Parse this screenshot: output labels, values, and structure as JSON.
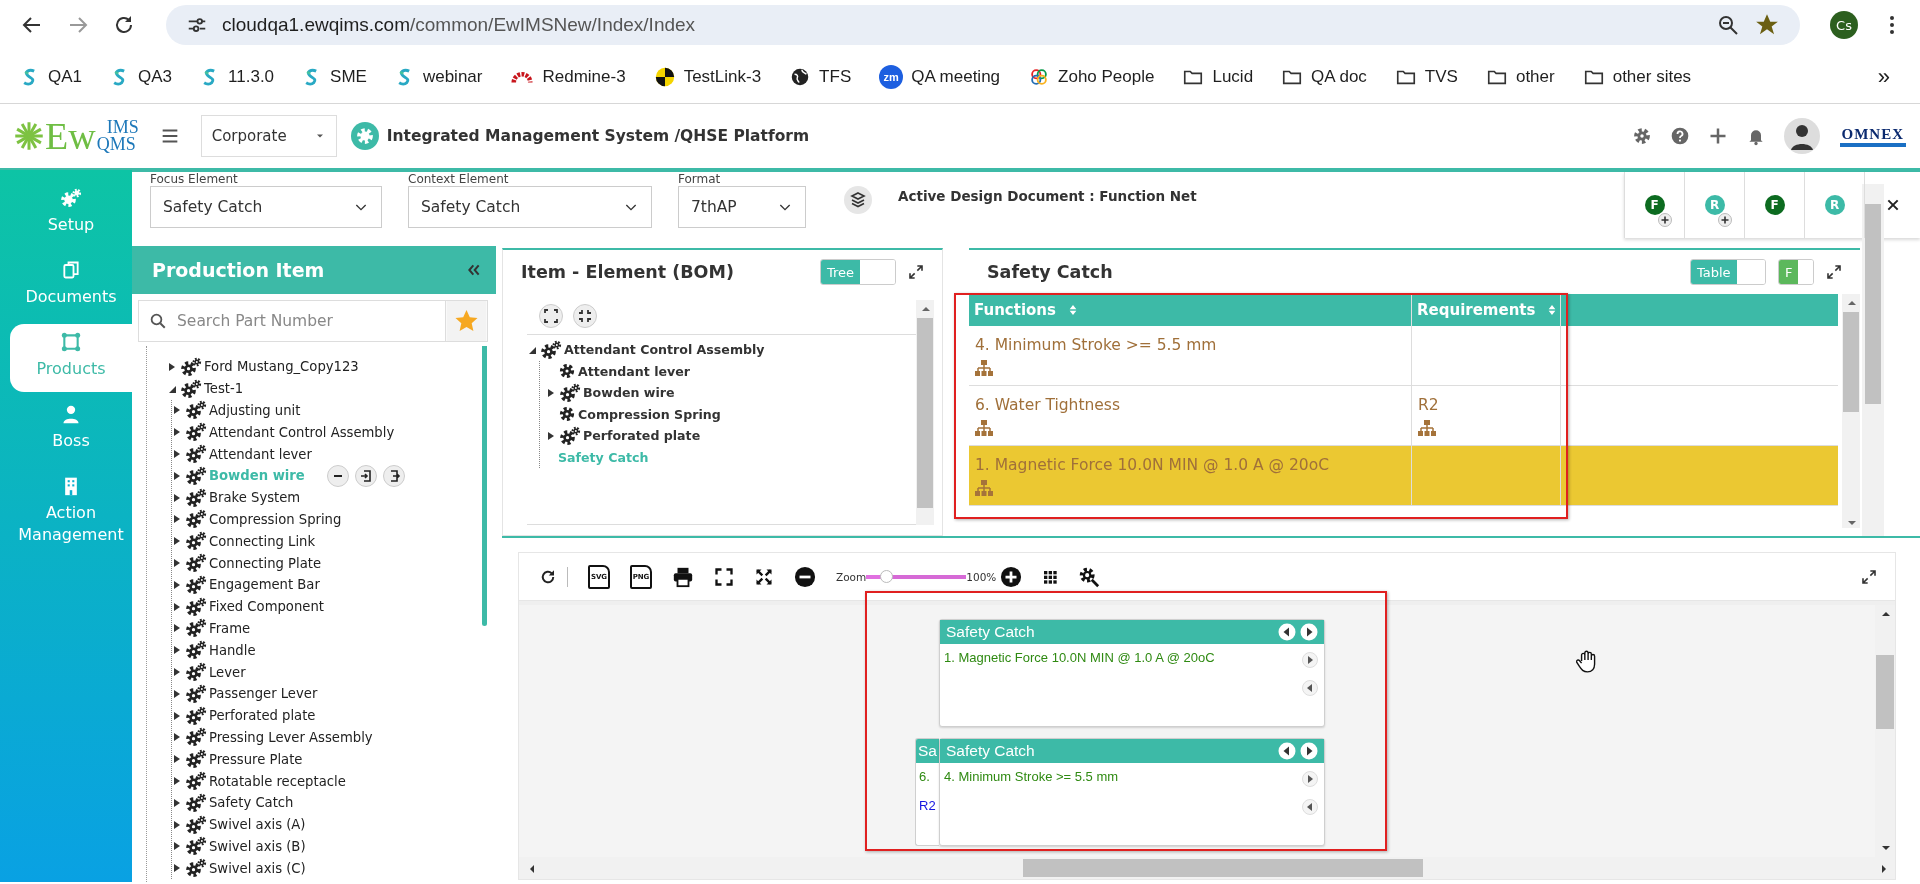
{
  "browser": {
    "url_host": "cloudqa1.ewqims.com",
    "url_path": "/common/EwIMSNew/Index/Index",
    "profile": "Cs"
  },
  "bookmarks": [
    {
      "label": "QA1",
      "kind": "ew"
    },
    {
      "label": "QA3",
      "kind": "ew"
    },
    {
      "label": "11.3.0",
      "kind": "ew"
    },
    {
      "label": "SME",
      "kind": "ew"
    },
    {
      "label": "webinar",
      "kind": "ew"
    },
    {
      "label": "Redmine-3",
      "kind": "redmine"
    },
    {
      "label": "TestLink-3",
      "kind": "testlink"
    },
    {
      "label": "TFS",
      "kind": "globe"
    },
    {
      "label": "QA meeting",
      "kind": "zm",
      "badge": "zm"
    },
    {
      "label": "Zoho People",
      "kind": "zoho"
    },
    {
      "label": "Lucid",
      "kind": "folder"
    },
    {
      "label": "QA doc",
      "kind": "folder"
    },
    {
      "label": "TVS",
      "kind": "folder"
    },
    {
      "label": "other",
      "kind": "folder"
    },
    {
      "label": "other sites",
      "kind": "folder"
    }
  ],
  "bookmarks_more": "»",
  "app": {
    "logo": {
      "main": "Ew",
      "top": "IMS",
      "bottom": "QMS"
    },
    "site": "Corporate",
    "title": "Integrated Management System /QHSE Platform",
    "brand": "OMNEX"
  },
  "nav": [
    {
      "label": "Setup",
      "kind": "gears",
      "selected": false
    },
    {
      "label": "Documents",
      "kind": "documents",
      "selected": false
    },
    {
      "label": "Products",
      "kind": "products",
      "selected": true
    },
    {
      "label": "Boss",
      "kind": "boss",
      "selected": false
    },
    {
      "label": "Action Management",
      "kind": "building",
      "selected": false
    }
  ],
  "filters": [
    {
      "label": "Focus Element",
      "value": "Safety Catch"
    },
    {
      "label": "Context Element",
      "value": "Safety Catch"
    },
    {
      "label": "Format",
      "value": "7thAP"
    }
  ],
  "active_document": "Active Design Document : Function Net",
  "view_buttons": [
    {
      "letter": "F",
      "kind": "function",
      "add": true
    },
    {
      "letter": "R",
      "kind": "requirement",
      "add": true
    },
    {
      "letter": "F",
      "kind": "function",
      "add": false
    },
    {
      "letter": "R",
      "kind": "requirement",
      "add": false
    }
  ],
  "production": {
    "title": "Production Item",
    "search_placeholder": "Search Part Number",
    "tree": [
      {
        "label": "Ford Mustang_Copy123",
        "expanded": false,
        "selected": false
      },
      {
        "label": "Test-1",
        "expanded": true,
        "selected": false,
        "children": [
          {
            "label": "Adjusting unit",
            "expanded": false,
            "selected": false
          },
          {
            "label": "Attendant Control Assembly",
            "expanded": false,
            "selected": false
          },
          {
            "label": "Attendant lever",
            "expanded": false,
            "selected": false
          },
          {
            "label": "Bowden wire",
            "expanded": false,
            "selected": true
          },
          {
            "label": "Brake System",
            "expanded": false,
            "selected": false
          },
          {
            "label": "Compression Spring",
            "expanded": false,
            "selected": false
          },
          {
            "label": "Connecting Link",
            "expanded": false,
            "selected": false
          },
          {
            "label": "Connecting Plate",
            "expanded": false,
            "selected": false
          },
          {
            "label": "Engagement Bar",
            "expanded": false,
            "selected": false
          },
          {
            "label": "Fixed Component",
            "expanded": false,
            "selected": false
          },
          {
            "label": "Frame",
            "expanded": false,
            "selected": false
          },
          {
            "label": "Handle",
            "expanded": false,
            "selected": false
          },
          {
            "label": "Lever",
            "expanded": false,
            "selected": false
          },
          {
            "label": "Passenger Lever",
            "expanded": false,
            "selected": false
          },
          {
            "label": "Perforated plate",
            "expanded": false,
            "selected": false
          },
          {
            "label": "Pressing Lever Assembly",
            "expanded": false,
            "selected": false
          },
          {
            "label": "Pressure Plate",
            "expanded": false,
            "selected": false
          },
          {
            "label": "Rotatable receptacle",
            "expanded": false,
            "selected": false
          },
          {
            "label": "Safety Catch",
            "expanded": false,
            "selected": false
          },
          {
            "label": "Swivel axis (A)",
            "expanded": false,
            "selected": false
          },
          {
            "label": "Swivel axis (B)",
            "expanded": false,
            "selected": false
          },
          {
            "label": "Swivel axis (C)",
            "expanded": false,
            "selected": false
          }
        ]
      }
    ]
  },
  "bom": {
    "title": "Item - Element (BOM)",
    "toggle": {
      "label": "Tree",
      "on": true
    },
    "tree": [
      {
        "label": "Attendant Control Assembly",
        "kind": "assembly",
        "expanded": true,
        "selected": false,
        "children": [
          {
            "label": "Attendant lever",
            "kind": "part",
            "selected": false
          },
          {
            "label": "Bowden wire",
            "kind": "assembly",
            "expanded": false,
            "selected": false
          },
          {
            "label": "Compression Spring",
            "kind": "part",
            "selected": false
          },
          {
            "label": "Perforated plate",
            "kind": "assembly",
            "expanded": false,
            "selected": false
          },
          {
            "label": "Safety Catch",
            "kind": "plain",
            "selected": true
          }
        ]
      }
    ]
  },
  "detail": {
    "highlighted": true,
    "title": "Safety Catch",
    "toggle": {
      "label": "Table",
      "on": true
    },
    "filter_toggle": {
      "label": "F",
      "on": true
    },
    "columns": [
      "Functions",
      "Requirements"
    ],
    "rows": [
      {
        "function": "4. Minimum Stroke >= 5.5 mm",
        "requirement": "",
        "selected": false
      },
      {
        "function": "6. Water Tightness",
        "requirement": "R2",
        "selected": false
      },
      {
        "function": "1. Magnetic Force 10.0N MIN @ 1.0 A @ 20oC",
        "requirement": "",
        "selected": true
      }
    ]
  },
  "diagram": {
    "highlighted": true,
    "export_buttons": [
      "SVG",
      "PNG"
    ],
    "zoom_label": "Zoom",
    "zoom": {
      "level": 0.2
    },
    "zoom_reading": "100%",
    "card_rows": [
      {
        "cards": [
          {
            "kind": "card",
            "title": "Safety Catch",
            "lines": [
              {
                "text": "1. Magnetic Force 10.0N MIN @ 1.0 A @ 20oC",
                "kind": "function"
              }
            ]
          }
        ]
      },
      {
        "cards": [
          {
            "kind": "partial",
            "title": "Sa",
            "lines": [
              {
                "text": "6.",
                "kind": "function"
              },
              {
                "text": "R2",
                "kind": "requirement"
              }
            ]
          },
          {
            "kind": "card",
            "title": "Safety Catch",
            "lines": [
              {
                "text": "4. Minimum Stroke >= 5.5 mm",
                "kind": "function"
              }
            ]
          }
        ]
      }
    ]
  }
}
